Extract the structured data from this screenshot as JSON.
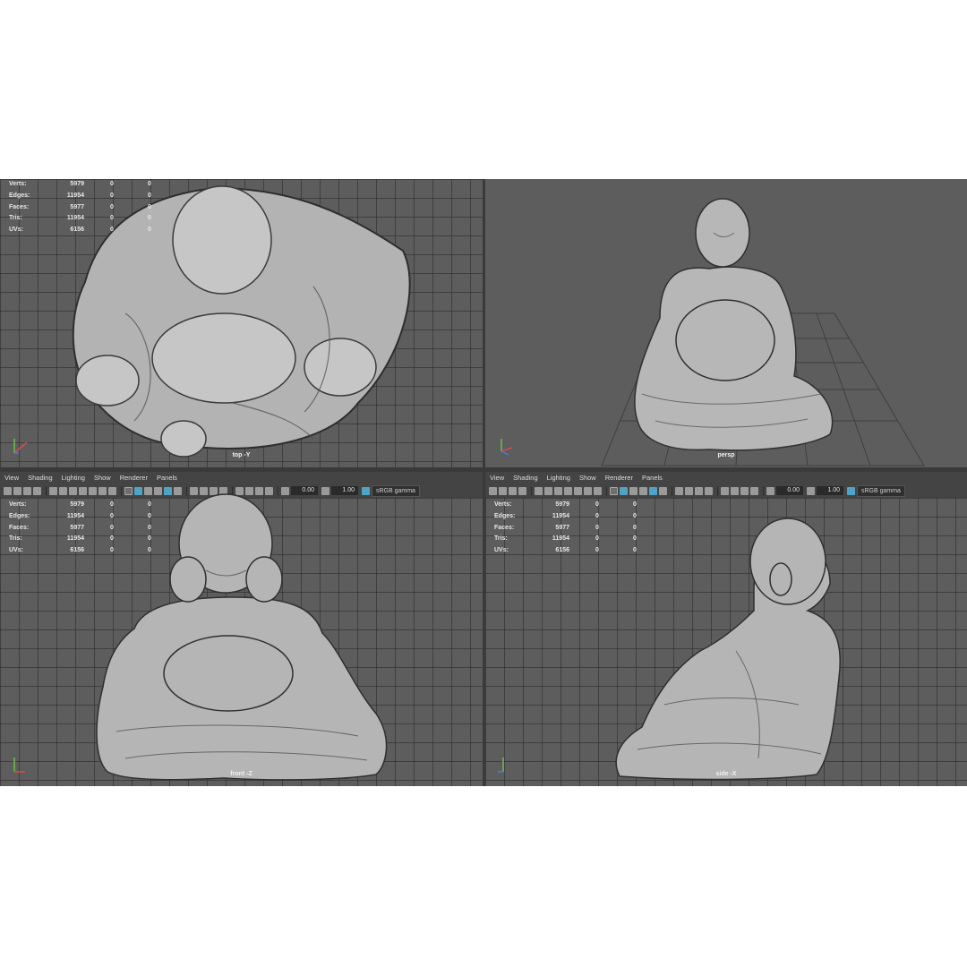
{
  "stats": {
    "labels": [
      "Verts:",
      "Edges:",
      "Faces:",
      "Tris:",
      "UVs:"
    ],
    "values": [
      "5979",
      "11954",
      "5977",
      "11954",
      "6156"
    ],
    "sel_a": [
      "0",
      "0",
      "0",
      "0",
      "0"
    ],
    "sel_b": [
      "0",
      "0",
      "0",
      "0",
      "0"
    ]
  },
  "menu": {
    "view": "View",
    "shading": "Shading",
    "lighting": "Lighting",
    "show": "Show",
    "renderer": "Renderer",
    "panels": "Panels"
  },
  "toolbar": {
    "exposure": "0.00",
    "gamma": "1.00",
    "color_space": "sRGB gamma"
  },
  "viewports": {
    "top": "top -Y",
    "persp": "persp",
    "front": "front -Z",
    "side": "side -X"
  },
  "colors": {
    "viewport_bg": "#5d5d5d",
    "grid_line": "#3a3a3a",
    "model": "#bdbdbd",
    "accent": "#4fa3c7"
  }
}
